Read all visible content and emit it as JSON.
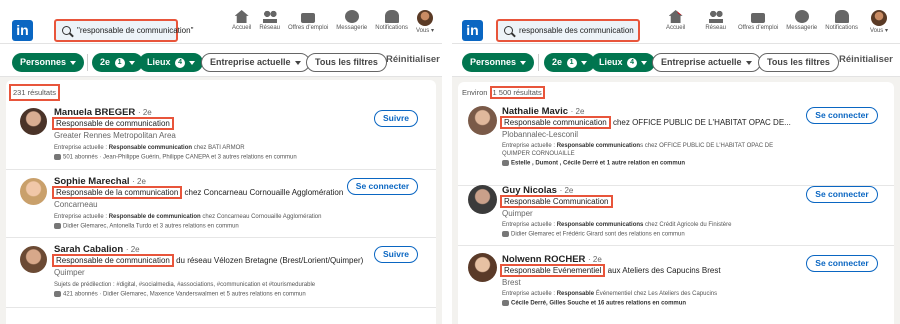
{
  "left": {
    "logo": "in",
    "search_query": "\"responsable de communication\"",
    "nav": [
      {
        "icon": "home-icon",
        "label": "Accueil"
      },
      {
        "icon": "network-icon",
        "label": "Réseau"
      },
      {
        "icon": "briefcase-icon",
        "label": "Offres d’emploi"
      },
      {
        "icon": "messaging-icon",
        "label": "Messagerie"
      },
      {
        "icon": "bell-icon",
        "label": "Notifications"
      },
      {
        "icon": "avatar-icon",
        "label": "Vous"
      }
    ],
    "filters": {
      "people": "Personnes",
      "degree": "2e",
      "degree_count": "1",
      "places": "Lieux",
      "places_count": "4",
      "company": "Entreprise actuelle",
      "all": "Tous les filtres",
      "reset": "Réinitialiser"
    },
    "count": "231 résultats",
    "results": [
      {
        "name": "Manuela BREGER",
        "degree": "· 2e",
        "headline": "Responsable de communication",
        "headline_rest": "",
        "location": "Greater Rennes Metropolitan Area",
        "current_prefix": "Entreprise actuelle : ",
        "current_bold": "Responsable communication",
        "current_rest": " chez BATI ARMOR",
        "connections": "501 abonnés · Jean-Philippe Guérin, Philippe CANEPA et 3 autres relations en commun",
        "action": "Suivre"
      },
      {
        "name": "Sophie Marechal",
        "degree": "· 2e",
        "headline": "Responsable de la communication",
        "headline_rest": " chez Concarneau Cornouaille Agglomération",
        "location": "Concarneau",
        "current_prefix": "Entreprise actuelle : ",
        "current_bold": "Responsable de communication",
        "current_rest": " chez Concarneau Cornouaille Agglomération",
        "connections": "Didier Glemarec, Antonella Turdo et 3 autres relations en commun",
        "action": "Se connecter"
      },
      {
        "name": "Sarah Cabalion",
        "degree": "· 2e",
        "headline": "Responsable de communication",
        "headline_rest": " du réseau Vélozen Bretagne (Brest/Lorient/Quimper)",
        "location": "Quimper",
        "current_prefix": "Sujets de prédilection : ",
        "current_bold": "",
        "current_rest": "#digital, #socialmedia, #associations, #communication et #tourismedurable",
        "connections": "421 abonnés · Didier Glemarec, Maxence Vanderswalmen et 5 autres relations en commun",
        "action": "Suivre"
      }
    ]
  },
  "right": {
    "logo": "in",
    "search_query": "responsable des communication",
    "nav": [
      {
        "icon": "home-icon",
        "label": "Accueil"
      },
      {
        "icon": "network-icon",
        "label": "Réseau"
      },
      {
        "icon": "briefcase-icon",
        "label": "Offres d’emploi"
      },
      {
        "icon": "messaging-icon",
        "label": "Messagerie"
      },
      {
        "icon": "bell-icon",
        "label": "Notifications"
      },
      {
        "icon": "avatar-icon",
        "label": "Vous"
      }
    ],
    "home_badge": "1",
    "filters": {
      "people": "Personnes",
      "degree": "2e",
      "degree_count": "1",
      "places": "Lieux",
      "places_count": "4",
      "company": "Entreprise actuelle",
      "all": "Tous les filtres",
      "reset": "Réinitialiser"
    },
    "count_prefix": "Environ ",
    "count": "1 500 résultats",
    "results": [
      {
        "name": "Nathalie Mavic",
        "degree": "· 2e",
        "headline": "Responsable communication",
        "headline_rest": " chez OFFICE PUBLIC DE L'HABITAT OPAC DE...",
        "location": "Plobannalec-Lesconil",
        "current_prefix": "Entreprise actuelle : ",
        "current_bold": "Responsable communication",
        "current_rest": "s chez OFFICE PUBLIC DE L'HABITAT OPAC DE",
        "current_line2": "QUIMPER CORNOUAILLE",
        "connections": "Estelle , Dumont , Cécile Derré et 1 autre relation en commun",
        "action": "Se connecter"
      },
      {
        "name": "Guy Nicolas",
        "degree": "· 2e",
        "headline": "Responsable Communication",
        "headline_rest": "",
        "location": "Quimper",
        "current_prefix": "Entreprise actuelle : ",
        "current_bold": "Responsable communications",
        "current_rest": " chez Crédit Agricole du Finistère",
        "connections": "Didier Glemarec et Frédéric Girard sont des relations en commun",
        "action": "Se connecter"
      },
      {
        "name": "Nolwenn ROCHER",
        "degree": "· 2e",
        "headline": "Responsable Evénementiel",
        "headline_rest": " aux Ateliers des Capucins Brest",
        "location": "Brest",
        "current_prefix": "Entreprise actuelle : ",
        "current_bold": "Responsable",
        "current_rest": " Événementiel chez Les Ateliers des Capucins",
        "connections": "Cécile Derré, Gilles Souche et 16 autres relations en commun",
        "action": "Se connecter"
      }
    ]
  }
}
